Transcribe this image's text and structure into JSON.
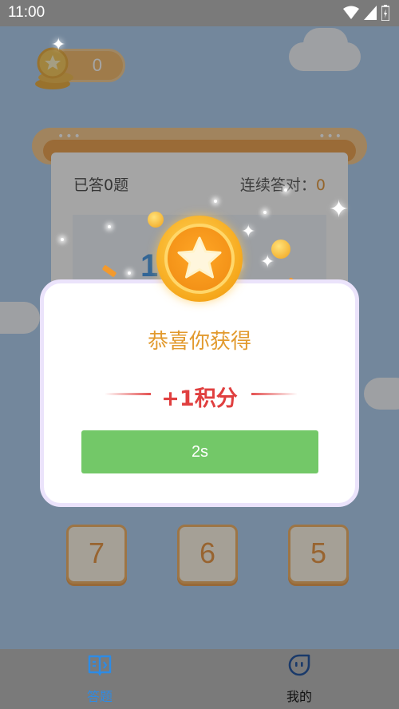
{
  "status_bar": {
    "time": "11:00"
  },
  "header": {
    "coins": "0"
  },
  "board": {
    "answered_label": "已答0题",
    "streak_label": "连续答对：",
    "streak_value": "0",
    "question_text": "1          ="
  },
  "options": [
    {
      "value": "7"
    },
    {
      "value": "6"
    },
    {
      "value": "5"
    }
  ],
  "reward_modal": {
    "title": "恭喜你获得",
    "reward": "+1积分",
    "countdown_button": "2s"
  },
  "bottom_nav": {
    "items": [
      {
        "label": "答题",
        "icon": "book-icon",
        "active": true
      },
      {
        "label": "我的",
        "icon": "face-icon",
        "active": false
      }
    ]
  },
  "colors": {
    "accent_orange": "#e29a2e",
    "reward_red": "#e03f3f",
    "button_green": "#73c868",
    "nav_active_blue": "#2d8be5"
  }
}
